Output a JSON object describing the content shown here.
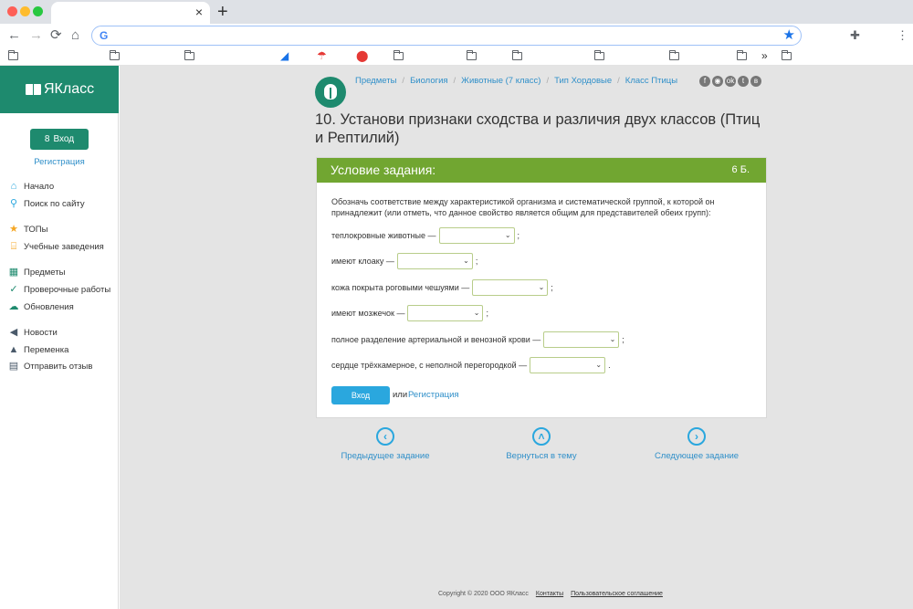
{
  "browser": {
    "tab_close": "×",
    "new_tab": "+",
    "nav": {
      "back": "←",
      "forward": "→",
      "reload": "⟳",
      "home": "⌂"
    },
    "omnibox": {
      "google_logo": "G",
      "value": "",
      "star": "★"
    },
    "extensions": "✚",
    "menu": "⋮",
    "bookmarks_more": "»"
  },
  "colors": {
    "brand_green": "#1e8a6e",
    "header_green": "#71a631",
    "link_blue": "#2f8fc9",
    "button_blue": "#2aa7de"
  },
  "sidebar": {
    "logo_text": "ЯКласс",
    "login_button": "Вход",
    "login_icon": "8",
    "register_link": "Регистрация",
    "items": [
      {
        "label": "Начало",
        "icon": "home-icon"
      },
      {
        "label": "Поиск по сайту",
        "icon": "search-icon"
      },
      {
        "label": "ТОПы",
        "icon": "star-icon"
      },
      {
        "label": "Учебные заведения",
        "icon": "school-icon"
      },
      {
        "label": "Предметы",
        "icon": "subjects-icon"
      },
      {
        "label": "Проверочные работы",
        "icon": "check-icon"
      },
      {
        "label": "Обновления",
        "icon": "cloud-icon"
      },
      {
        "label": "Новости",
        "icon": "megaphone-icon"
      },
      {
        "label": "Переменка",
        "icon": "bell-icon"
      },
      {
        "label": "Отправить отзыв",
        "icon": "feedback-icon"
      }
    ]
  },
  "breadcrumbs": [
    "Предметы",
    "Биология",
    "Животные (7 класс)",
    "Тип Хордовые",
    "Класс Птицы"
  ],
  "breadcrumb_separator": "/",
  "socials": [
    "f",
    "◉",
    "ok",
    "t",
    "в"
  ],
  "title": "10. Установи признаки сходства и различия двух классов (Птиц и Рептилий)",
  "task": {
    "header": "Условие задания:",
    "points": "6 Б.",
    "instruction": "Обозначь соответствие между характеристикой организма и систематической группой, к которой он принадлежит (или отметь, что данное свойство является общим для представителей обеих групп):",
    "rows": [
      {
        "label": "теплокровные животные —",
        "punct": ";"
      },
      {
        "label": "имеют клоаку —",
        "punct": ";"
      },
      {
        "label": "кожа покрыта роговыми чешуями —",
        "punct": ";"
      },
      {
        "label": "имеют мозжечок —",
        "punct": ";"
      },
      {
        "label": "полное разделение артериальной и венозной крови —",
        "punct": ";"
      },
      {
        "label": "сердце трёхкамерное, с неполной перегородкой —",
        "punct": "."
      }
    ],
    "select_value": "",
    "select_arrow": "⌄",
    "login_button": "Вход",
    "or_text": "или",
    "register_link": "Регистрация"
  },
  "pager": {
    "prev": {
      "label": "Предыдущее задание",
      "glyph": "‹"
    },
    "up": {
      "label": "Вернуться в тему",
      "glyph": "˄"
    },
    "next": {
      "label": "Следующее задание",
      "glyph": "›"
    }
  },
  "footer": {
    "copyright": "Copyright © 2020 ООО ЯКласс",
    "contacts": "Контакты",
    "agreement": "Пользовательское соглашение"
  }
}
